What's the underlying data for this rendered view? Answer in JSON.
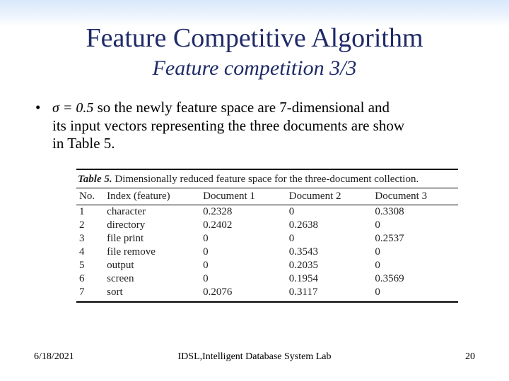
{
  "title": "Feature Competitive Algorithm",
  "subtitle": "Feature competition 3/3",
  "bullet": {
    "sigma_expr": "σ = 0.5",
    "line1_after_sigma": " so the newly feature space are 7-dimensional and",
    "line2": "its input vectors representing the three documents are show",
    "line3": "in Table 5."
  },
  "table": {
    "caption_strong": "Table 5.",
    "caption_rest": "  Dimensionally reduced feature space for the three-document collection.",
    "headers": [
      "No.",
      "Index (feature)",
      "Document 1",
      "Document 2",
      "Document 3"
    ],
    "rows": [
      {
        "no": "1",
        "idx": "character",
        "d1": "0.2328",
        "d2": "0",
        "d3": "0.3308"
      },
      {
        "no": "2",
        "idx": "directory",
        "d1": "0.2402",
        "d2": "0.2638",
        "d3": "0"
      },
      {
        "no": "3",
        "idx": "file print",
        "d1": "0",
        "d2": "0",
        "d3": "0.2537"
      },
      {
        "no": "4",
        "idx": "file remove",
        "d1": "0",
        "d2": "0.3543",
        "d3": "0"
      },
      {
        "no": "5",
        "idx": "output",
        "d1": "0",
        "d2": "0.2035",
        "d3": "0"
      },
      {
        "no": "6",
        "idx": "screen",
        "d1": "0",
        "d2": "0.1954",
        "d3": "0.3569"
      },
      {
        "no": "7",
        "idx": "sort",
        "d1": "0.2076",
        "d2": "0.3117",
        "d3": "0"
      }
    ]
  },
  "footer": {
    "date": "6/18/2021",
    "center": "IDSL,Intelligent Database System Lab",
    "page": "20"
  }
}
